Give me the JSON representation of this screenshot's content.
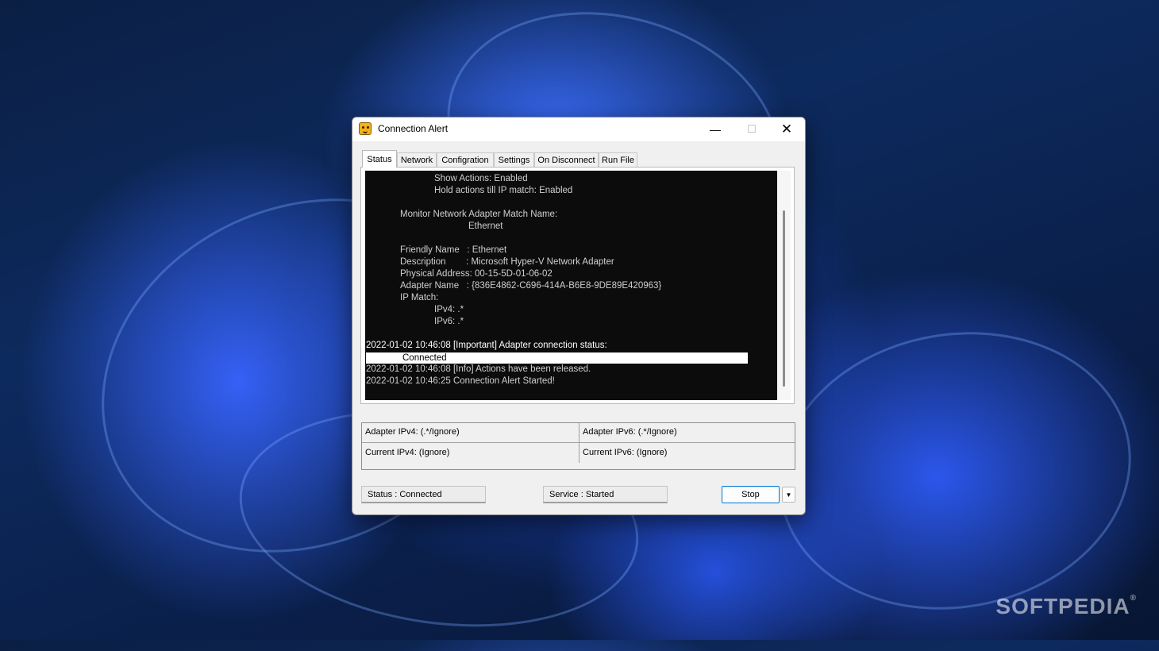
{
  "window": {
    "title": "Connection Alert",
    "minimize_glyph": "—",
    "maximize_glyph": "☐",
    "close_glyph": "✕"
  },
  "tabs": [
    {
      "label": "Status",
      "active": true
    },
    {
      "label": "Network",
      "active": false
    },
    {
      "label": "Configration",
      "active": false
    },
    {
      "label": "Settings",
      "active": false
    },
    {
      "label": "On Disconnect",
      "active": false
    },
    {
      "label": "Run File",
      "active": false
    }
  ],
  "log": [
    "Show Actions: Enabled",
    "Hold actions till IP match: Enabled",
    "Monitor Network Adapter Match Name:",
    "Ethernet",
    "Friendly Name   : Ethernet",
    "Description        : Microsoft Hyper-V Network Adapter",
    "Physical Address: 00-15-5D-01-06-02",
    "Adapter Name   : {836E4862-C696-414A-B6E8-9DE89E420963}",
    "IP Match:",
    "IPv4: .*",
    "IPv6: .*",
    "2022-01-02 10:46:08 [Important] Adapter connection status:",
    "Connected",
    "2022-01-02 10:46:08 [Info] Actions have been released.",
    "2022-01-02 10:46:25 Connection Alert Started!"
  ],
  "ip_table": {
    "adapter_ipv4": "Adapter IPv4: (.*/Ignore)",
    "adapter_ipv6": "Adapter IPv6: (.*/Ignore)",
    "current_ipv4": "Current IPv4: (Ignore)",
    "current_ipv6": "Current IPv6: (Ignore)"
  },
  "footer": {
    "status": "Status : Connected",
    "service": "Service : Started",
    "stop_label": "Stop",
    "dropdown_glyph": "▼"
  },
  "watermark": "SOFTPEDIA",
  "colors": {
    "accent": "#0078d4",
    "log_background": "#0c0c0c",
    "log_text": "#cfcfcf"
  }
}
